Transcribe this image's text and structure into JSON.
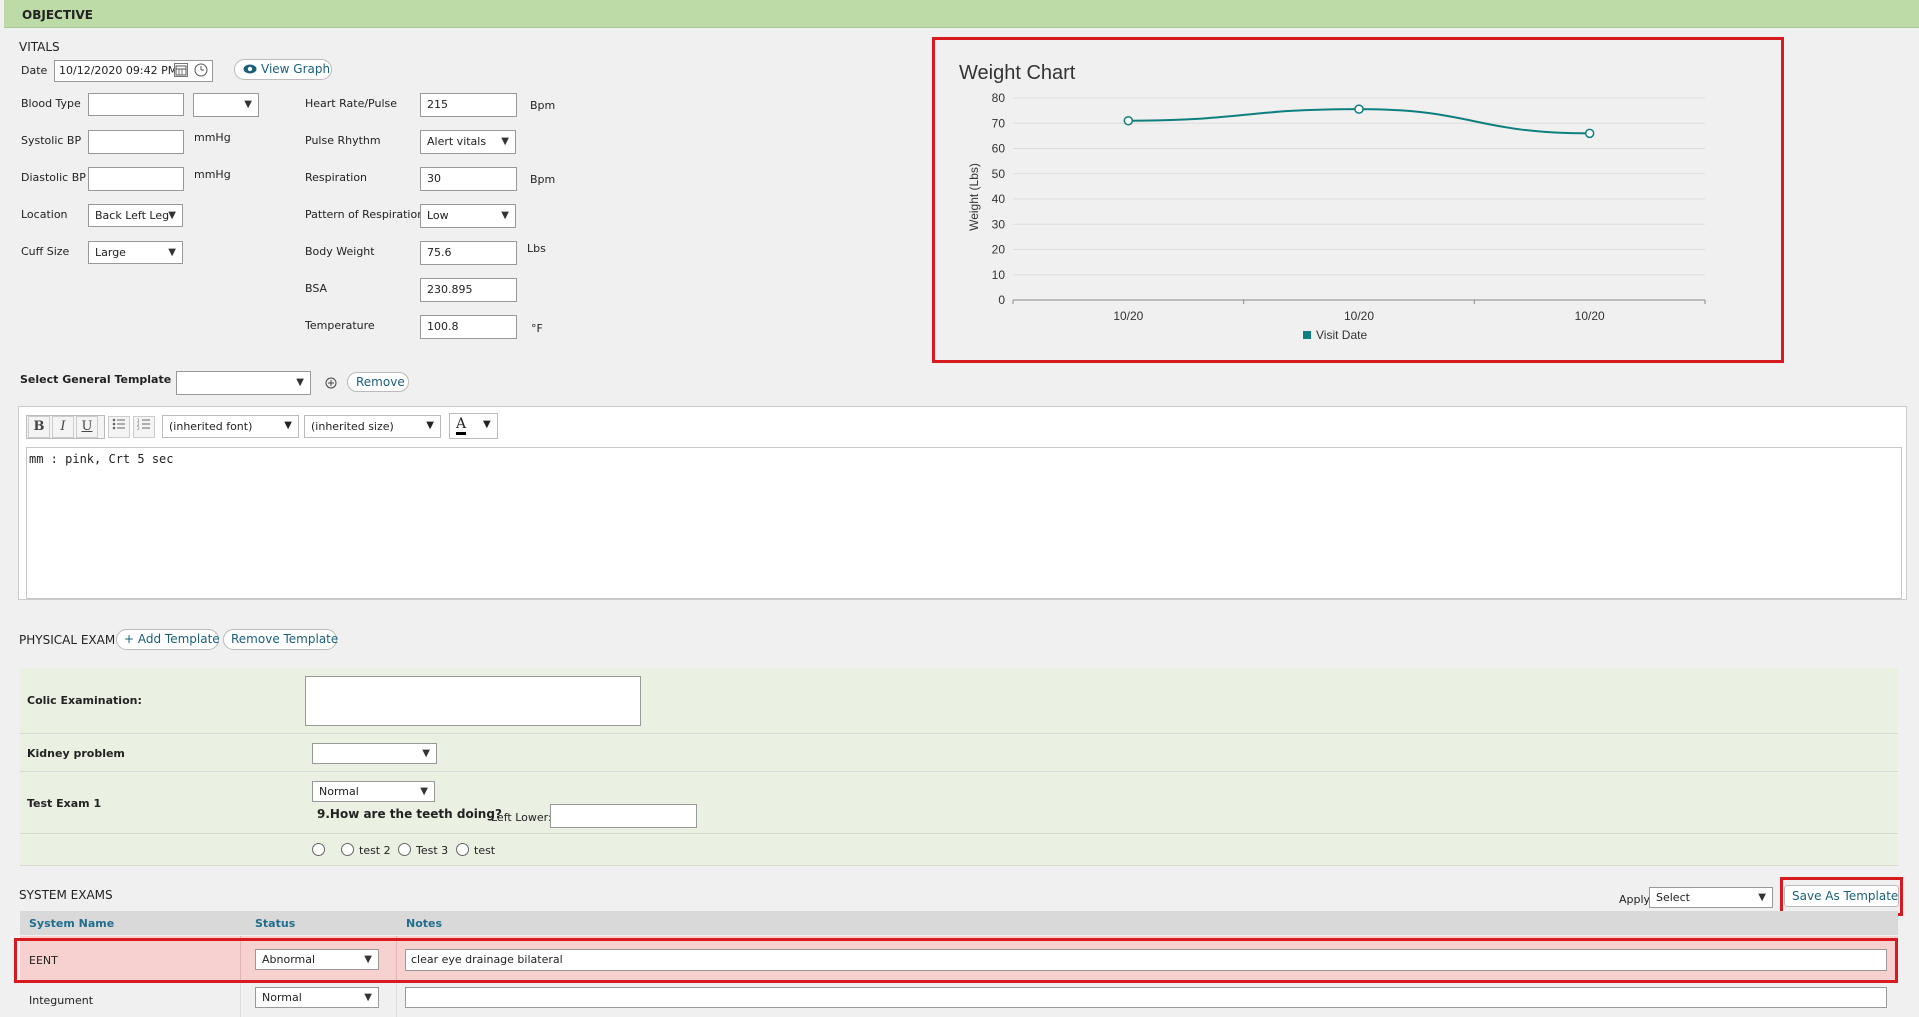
{
  "section": {
    "title": "OBJECTIVE"
  },
  "vitals": {
    "heading": "VITALS",
    "date_label": "Date",
    "date_value": "10/12/2020 09:42 PM",
    "view_graph_label": "View Graph",
    "blood_type_label": "Blood Type",
    "systolic_label": "Systolic BP",
    "diastolic_label": "Diastolic BP",
    "location_label": "Location",
    "location_value": "Back Left Leg",
    "cuff_label": "Cuff Size",
    "cuff_value": "Large",
    "mmhg": "mmHg",
    "heart_label": "Heart Rate/Pulse",
    "heart_value": "215",
    "bpm": "Bpm",
    "pulse_rhythm_label": "Pulse Rhythm",
    "pulse_rhythm_value": "Alert vitals",
    "respiration_label": "Respiration",
    "respiration_value": "30",
    "pattern_label": "Pattern of Respiration",
    "pattern_value": "Low",
    "weight_label": "Body Weight",
    "weight_value": "75.6",
    "lbs": "Lbs",
    "bsa_label": "BSA",
    "bsa_value": "230.895",
    "temp_label": "Temperature",
    "temp_value": "100.8",
    "temp_unit": "°F"
  },
  "chart_data": {
    "type": "line",
    "title": "Weight Chart",
    "categories": [
      "10/20",
      "10/20",
      "10/20"
    ],
    "series": [
      {
        "name": "Visit Date",
        "values": [
          71,
          75.6,
          66
        ],
        "color": "#0d7f7f"
      }
    ],
    "ylabel": "Weight (Lbs)",
    "xlabel": "",
    "ylim": [
      0,
      80
    ],
    "yticks": [
      "0",
      "10",
      "20",
      "30",
      "40",
      "50",
      "60",
      "70",
      "80"
    ],
    "grid": true,
    "legend": "bottom"
  },
  "template": {
    "label": "Select General Template",
    "remove_label": "Remove"
  },
  "editor": {
    "font_value": "(inherited font)",
    "size_value": "(inherited size)",
    "bold": "B",
    "italic": "I",
    "underline": "U",
    "font_color": "A",
    "content": "mm : pink, Crt 5 sec"
  },
  "physical_exam": {
    "heading": "PHYSICAL EXAM",
    "add_template": "Add Template",
    "remove_template": "Remove Template",
    "colic_label": "Colic Examination:",
    "kidney_label": "Kidney problem",
    "test_exam_label": "Test Exam 1",
    "test_exam_value": "Normal",
    "teeth_question": "9.How are the teeth doing?",
    "left_lower_label": "Left Lower:",
    "radio_options": [
      "",
      "test 2",
      "Test 3",
      "test"
    ]
  },
  "system_exams": {
    "heading": "SYSTEM EXAMS",
    "apply_label": "Apply",
    "apply_value": "Select",
    "save_template": "Save As Template",
    "col_name": "System Name",
    "col_status": "Status",
    "col_notes": "Notes",
    "rows": [
      {
        "name": "EENT",
        "status": "Abnormal",
        "notes": "clear eye drainage bilateral"
      },
      {
        "name": "Integument",
        "status": "Normal",
        "notes": ""
      }
    ]
  },
  "colors": {
    "accent": "#1a5f7a",
    "highlight": "#d71920",
    "section": "#bcdba6"
  }
}
